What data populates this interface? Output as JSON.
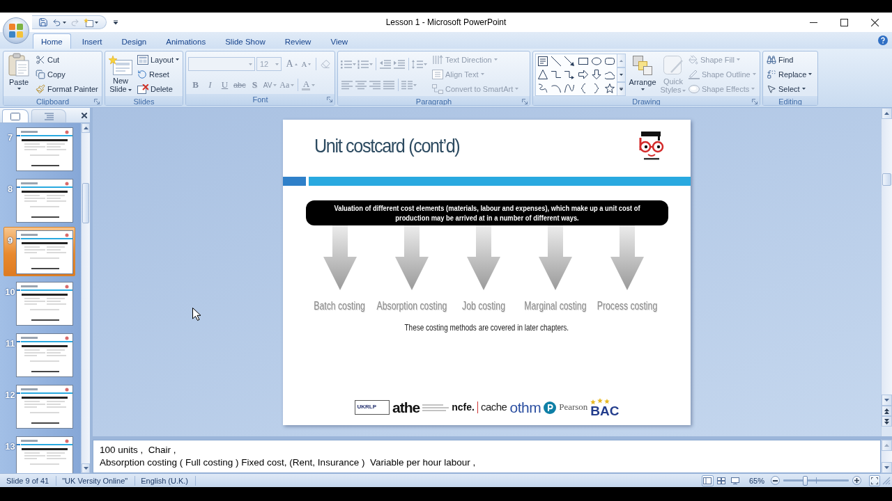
{
  "window": {
    "title": "Lesson 1 - Microsoft PowerPoint"
  },
  "tabs": [
    {
      "label": "Home",
      "selected": true
    },
    {
      "label": "Insert",
      "selected": false
    },
    {
      "label": "Design",
      "selected": false
    },
    {
      "label": "Animations",
      "selected": false
    },
    {
      "label": "Slide Show",
      "selected": false
    },
    {
      "label": "Review",
      "selected": false
    },
    {
      "label": "View",
      "selected": false
    }
  ],
  "ribbon": {
    "clipboard": {
      "label": "Clipboard",
      "launcher": true,
      "paste": {
        "label": "Paste",
        "menu": true,
        "disabled": false
      },
      "commands": [
        {
          "label": "Cut",
          "menu": false,
          "disabled": false
        },
        {
          "label": "Copy",
          "menu": false,
          "disabled": false
        },
        {
          "label": "Format Painter",
          "menu": false,
          "disabled": false
        }
      ]
    },
    "slides": {
      "label": "Slides",
      "launcher": false,
      "new_slide": {
        "label": "New Slide",
        "menu": true,
        "disabled": false
      },
      "commands": [
        {
          "label": "Layout",
          "menu": true,
          "disabled": false
        },
        {
          "label": "Reset",
          "menu": false,
          "disabled": false
        },
        {
          "label": "Delete",
          "menu": false,
          "disabled": false
        }
      ]
    },
    "font": {
      "label": "Font",
      "launcher": true,
      "font_name": {
        "disabled": true
      },
      "font_size": {
        "value": "12",
        "disabled": true
      },
      "size_buttons": [
        {
          "kind": "grow",
          "glyph": "A",
          "disabled": true
        },
        {
          "kind": "shrink",
          "glyph": "A",
          "disabled": true
        }
      ],
      "clear_formatting": {
        "disabled": true
      },
      "formats": [
        {
          "kind": "bold",
          "glyph": "B",
          "menu": false,
          "disabled": true
        },
        {
          "kind": "italic",
          "glyph": "I",
          "menu": false,
          "disabled": true
        },
        {
          "kind": "underline",
          "glyph": "U",
          "menu": false,
          "disabled": true
        },
        {
          "kind": "strike",
          "glyph": "abc",
          "menu": false,
          "disabled": true
        },
        {
          "kind": "shadow",
          "glyph": "S",
          "menu": false,
          "disabled": true
        },
        {
          "kind": "spacing",
          "glyph": "AV",
          "menu": true,
          "disabled": true
        },
        {
          "kind": "case",
          "glyph": "Aa",
          "menu": true,
          "disabled": true
        }
      ],
      "font_color": {
        "glyph": "A",
        "menu": true,
        "disabled": true
      }
    },
    "paragraph": {
      "label": "Paragraph",
      "launcher": true,
      "tool_rows": [
        [
          {
            "kind": "bullets",
            "menu": true,
            "disabled": true
          },
          {
            "kind": "numbering",
            "menu": true,
            "disabled": true
          },
          {
            "kind": "decrease-indent",
            "menu": false,
            "disabled": true
          },
          {
            "kind": "increase-indent",
            "menu": false,
            "disabled": true
          },
          {
            "kind": "line-spacing",
            "menu": true,
            "disabled": true
          }
        ],
        [
          {
            "kind": "align-left",
            "menu": false,
            "disabled": true
          },
          {
            "kind": "center",
            "menu": false,
            "disabled": true
          },
          {
            "kind": "align-right",
            "menu": false,
            "disabled": true
          },
          {
            "kind": "justify",
            "menu": false,
            "disabled": true
          },
          {
            "kind": "columns",
            "menu": true,
            "disabled": true
          }
        ]
      ],
      "commands": [
        {
          "label": "Text Direction",
          "menu": true,
          "disabled": true
        },
        {
          "label": "Align Text",
          "menu": true,
          "disabled": true
        },
        {
          "label": "Convert to SmartArt",
          "menu": true,
          "disabled": true
        }
      ]
    },
    "drawing": {
      "label": "Drawing",
      "launcher": true,
      "arrange": {
        "label": "Arrange",
        "menu": true,
        "disabled": false
      },
      "quick_styles": {
        "label": "Quick Styles",
        "menu": true,
        "disabled": true
      },
      "commands": [
        {
          "label": "Shape Fill",
          "menu": true,
          "disabled": true
        },
        {
          "label": "Shape Outline",
          "menu": true,
          "disabled": true
        },
        {
          "label": "Shape Effects",
          "menu": true,
          "disabled": true
        }
      ]
    },
    "editing": {
      "label": "Editing",
      "launcher": false,
      "commands": [
        {
          "label": "Find",
          "menu": false,
          "disabled": false
        },
        {
          "label": "Replace",
          "menu": true,
          "disabled": false
        },
        {
          "label": "Select",
          "menu": true,
          "disabled": false
        }
      ]
    }
  },
  "slides_panel": {
    "tabs": [
      {
        "kind": "slides",
        "selected": true
      },
      {
        "kind": "outline",
        "selected": false
      }
    ],
    "slides": [
      {
        "number": "7",
        "selected": false
      },
      {
        "number": "8",
        "selected": false
      },
      {
        "number": "9",
        "selected": true
      },
      {
        "number": "10",
        "selected": false
      },
      {
        "number": "11",
        "selected": false
      },
      {
        "number": "12",
        "selected": false
      },
      {
        "number": "13",
        "selected": false
      }
    ]
  },
  "slide": {
    "title": "Unit costcard (cont’d)",
    "banner": "Valuation of different cost elements (materials, labour and expenses), which make up a unit cost of production may be arrived at in a number of different ways.",
    "methods": [
      "Batch costing",
      "Absorption costing",
      "Job costing",
      "Marginal costing",
      "Process costing"
    ],
    "note": "These costing methods are covered in later chapters.",
    "partners": [
      {
        "kind": "boxed",
        "text": "UKRLP"
      },
      {
        "kind": "heavy",
        "text": "athe"
      },
      {
        "kind": "bold",
        "text": "ncfe."
      },
      {
        "kind": "divided",
        "text": "cache"
      },
      {
        "kind": "thin",
        "text": "othm"
      },
      {
        "kind": "ring",
        "text": "Pearson"
      },
      {
        "kind": "starred",
        "text": "BAC"
      }
    ]
  },
  "notes": {
    "lines": [
      "100 units ,  Chair ,",
      "Absorption costing ( Full costing ) Fixed cost, (Rent, Insurance )  Variable per hour labour ,"
    ]
  },
  "status_bar": {
    "slide_position": "Slide 9 of 41",
    "theme": "\"UK Versity Online\"",
    "language": "English (U.K.)",
    "views": [
      {
        "kind": "normal",
        "selected": true
      },
      {
        "kind": "sorter",
        "selected": false
      },
      {
        "kind": "show",
        "selected": false
      }
    ],
    "zoom": {
      "reading": "65%",
      "level": 0.33
    }
  }
}
